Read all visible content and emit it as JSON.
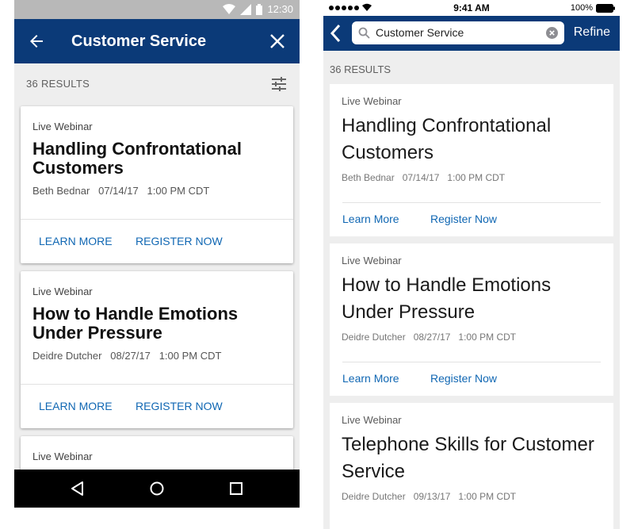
{
  "android": {
    "status_time": "12:30",
    "title": "Customer Service",
    "results_label": "36 RESULTS",
    "cards": [
      {
        "eyebrow": "Live Webinar",
        "title": "Handling Confrontational Customers",
        "meta": "Beth Bednar   07/14/17   1:00 PM CDT",
        "learn": "LEARN MORE",
        "register": "REGISTER NOW"
      },
      {
        "eyebrow": "Live Webinar",
        "title": "How to Handle Emotions Under Pressure",
        "meta": "Deidre Dutcher   08/27/17   1:00 PM CDT",
        "learn": "LEARN MORE",
        "register": "REGISTER NOW"
      },
      {
        "eyebrow": "Live Webinar"
      }
    ],
    "colors": {
      "appbar": "#0b3a78",
      "link": "#1067b3"
    }
  },
  "ios": {
    "status_time": "9:41 AM",
    "battery": "100%",
    "search_value": "Customer Service",
    "refine": "Refine",
    "results_label": "36 RESULTS",
    "cards": [
      {
        "eyebrow": "Live Webinar",
        "title": "Handling Confrontational Customers",
        "meta": "Beth Bednar   07/14/17   1:00 PM CDT",
        "learn": "Learn More",
        "register": "Register Now"
      },
      {
        "eyebrow": "Live Webinar",
        "title": "How to Handle Emotions Under Pressure",
        "meta": "Deidre Dutcher   08/27/17   1:00 PM CDT",
        "learn": "Learn More",
        "register": "Register Now"
      },
      {
        "eyebrow": "Live Webinar",
        "title": "Telephone Skills for Customer Service",
        "meta": "Deidre Dutcher   09/13/17   1:00 PM CDT"
      }
    ],
    "colors": {
      "navbar": "#0b3a78",
      "link": "#1067b3"
    }
  },
  "icons": [
    "wifi-icon",
    "signal-icon",
    "battery-icon",
    "back-arrow-icon",
    "close-icon",
    "filter-icon",
    "nav-back-icon",
    "nav-home-icon",
    "nav-recents-icon",
    "chevron-left-icon",
    "search-icon",
    "clear-icon"
  ]
}
